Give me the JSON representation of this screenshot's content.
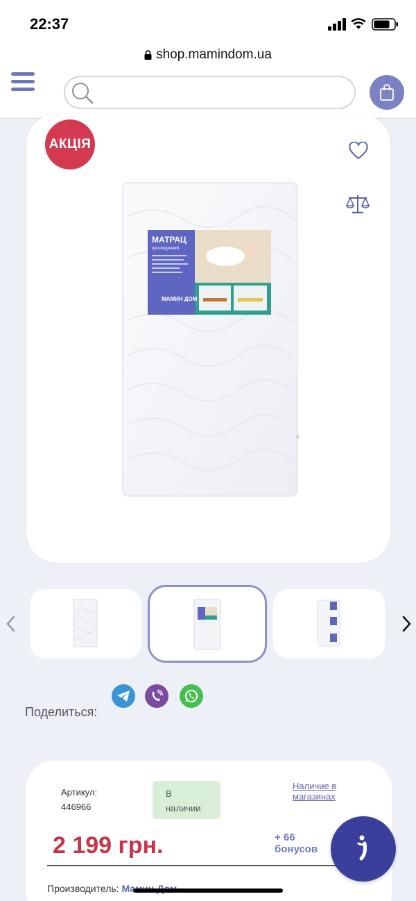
{
  "status_bar": {
    "time": "22:37"
  },
  "browser": {
    "url": "shop.mamindom.ua"
  },
  "header": {
    "search_placeholder": ""
  },
  "product": {
    "sale_badge": "АКЦІЯ",
    "image_label_title": "МАТРАЦ",
    "image_label_subtitle": "ортопедичний",
    "image_label_brand": "МАМИН ДОМ"
  },
  "share": {
    "label": "Поделиться:"
  },
  "info": {
    "sku_label": "Артикул:",
    "sku_value": "446966",
    "stock_line1": "В",
    "stock_line2": "наличии",
    "availability_link": "Наличие в магазинах",
    "price": "2 199 грн.",
    "bonus_line1": "+ 66",
    "bonus_line2": "бонусов",
    "maker_label": "Производитель:",
    "maker_value": "Мамин Дом"
  },
  "colors": {
    "accent": "#7b82c4",
    "sale": "#d33a4f",
    "price": "#c8334a",
    "stock_bg": "#d8eed8"
  }
}
